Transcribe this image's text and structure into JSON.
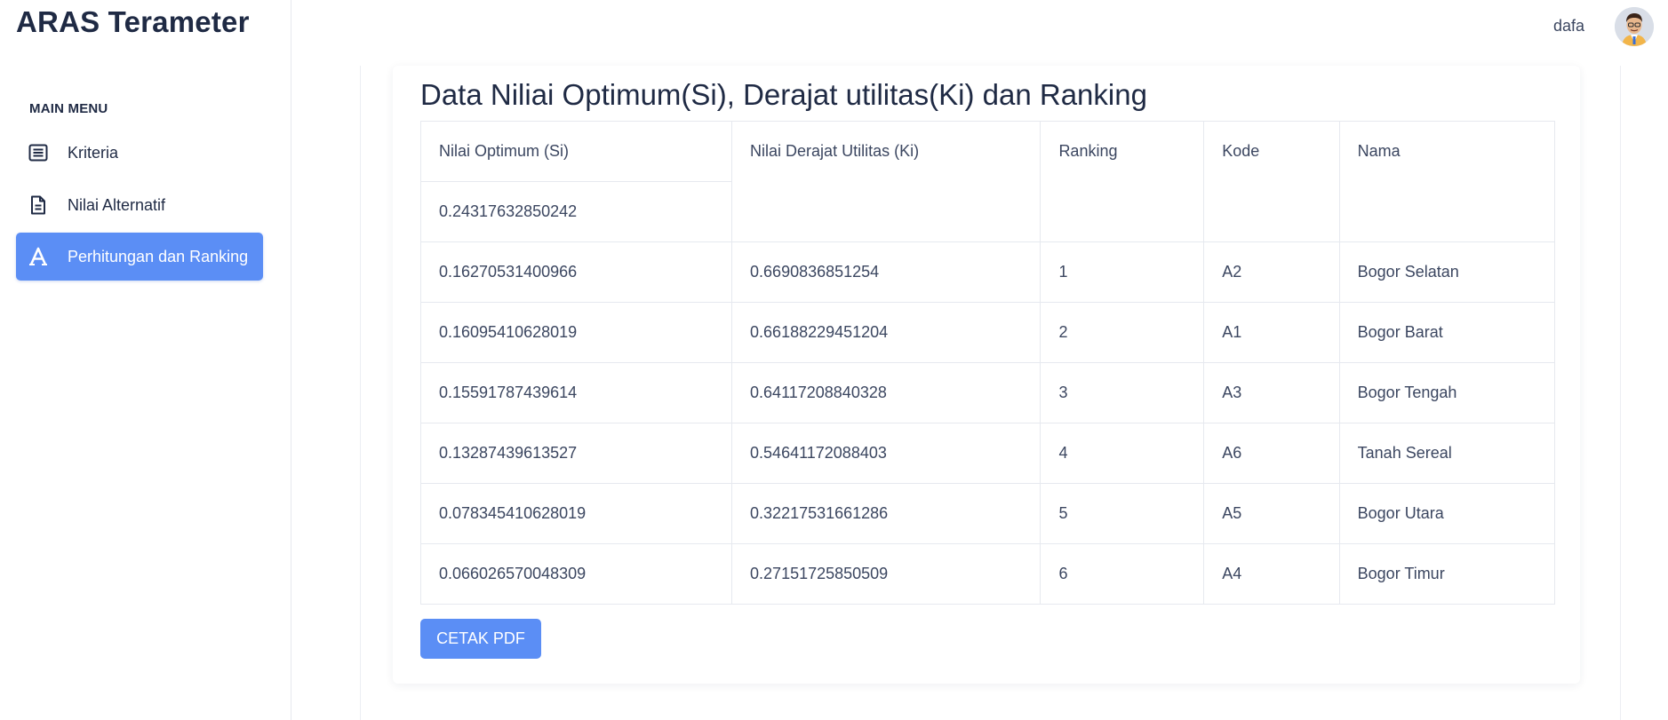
{
  "app": {
    "title": "ARAS Terameter"
  },
  "user": {
    "name": "dafa"
  },
  "sidebar": {
    "section_title": "MAIN MENU",
    "items": [
      {
        "label": "Kriteria",
        "icon": "list-icon",
        "active": false
      },
      {
        "label": "Nilai Alternatif",
        "icon": "document-icon",
        "active": false
      },
      {
        "label": "Perhitungan dan Ranking",
        "icon": "letter-a-icon",
        "active": true
      }
    ]
  },
  "main": {
    "card_title": "Data Niliai Optimum(Si), Derajat utilitas(Ki) dan Ranking",
    "table": {
      "headers": [
        "Nilai Optimum (Si)",
        "Nilai Derajat Utilitas (Ki)",
        "Ranking",
        "Kode",
        "Nama"
      ],
      "first_si": "0.24317632850242",
      "rows": [
        [
          "0.16270531400966",
          "0.6690836851254",
          "1",
          "A2",
          "Bogor Selatan"
        ],
        [
          "0.16095410628019",
          "0.66188229451204",
          "2",
          "A1",
          "Bogor Barat"
        ],
        [
          "0.15591787439614",
          "0.64117208840328",
          "3",
          "A3",
          "Bogor Tengah"
        ],
        [
          "0.13287439613527",
          "0.54641172088403",
          "4",
          "A6",
          "Tanah Sereal"
        ],
        [
          "0.078345410628019",
          "0.32217531661286",
          "5",
          "A5",
          "Bogor Utara"
        ],
        [
          "0.066026570048309",
          "0.27151725850509",
          "6",
          "A4",
          "Bogor Timur"
        ]
      ]
    },
    "print_button": "CETAK PDF"
  },
  "colors": {
    "accent": "#5b8ef5",
    "text_dark": "#1f2a44",
    "text": "#3b4660",
    "border": "#e6e9ef"
  }
}
